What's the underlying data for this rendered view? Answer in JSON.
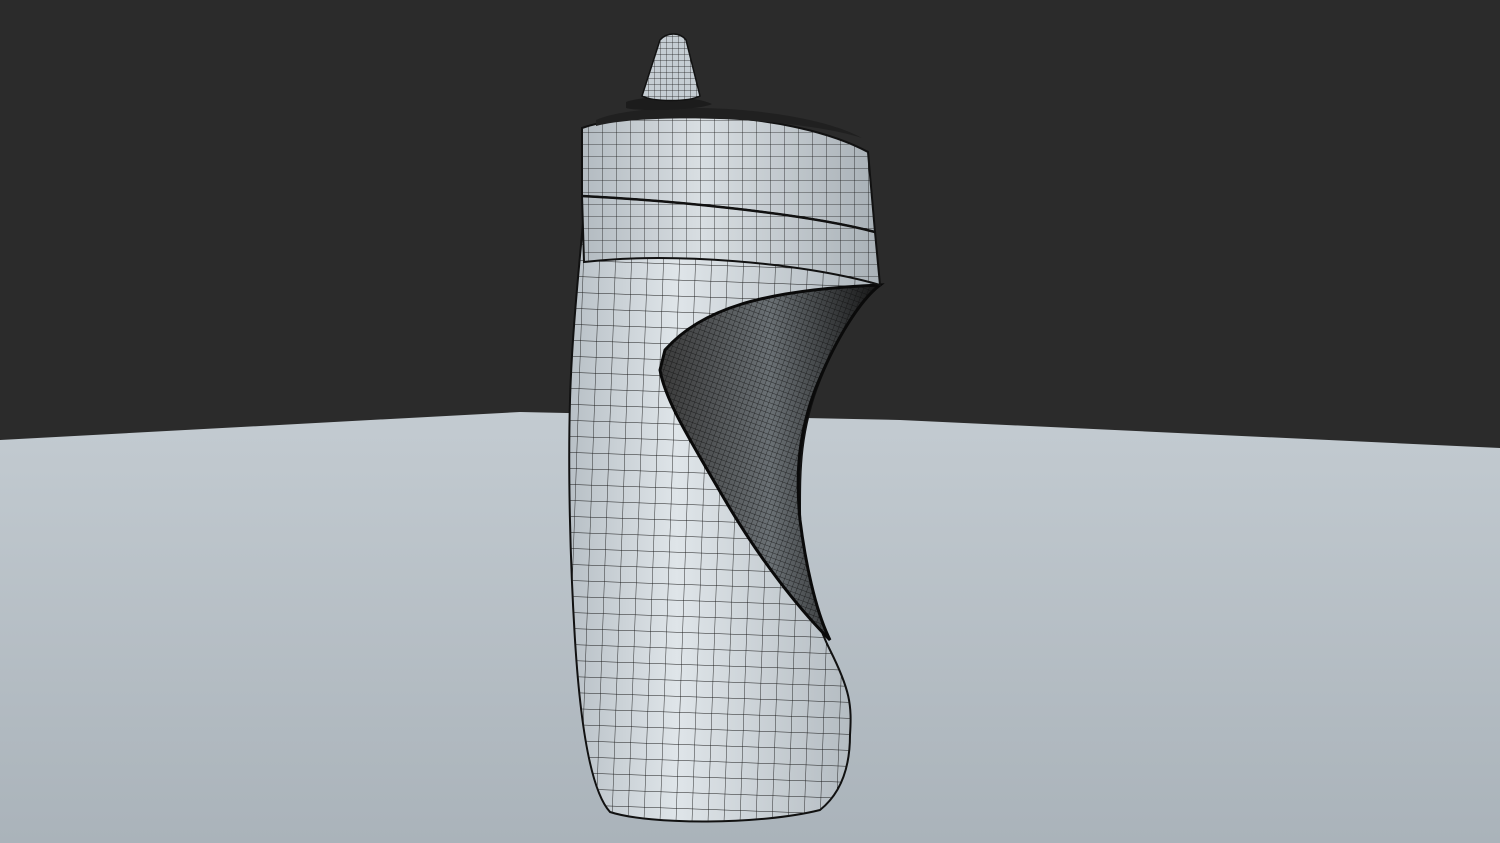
{
  "scene": {
    "background_color": "#2b2b2b",
    "floor_color": "#b3bcc3",
    "object": "wireframe-squeeze-bottle",
    "shading": "wireframe-over-solid",
    "mesh_color": "#c9d1d7",
    "wire_color": "#1a1a1a",
    "cutout_color": "#121212"
  }
}
